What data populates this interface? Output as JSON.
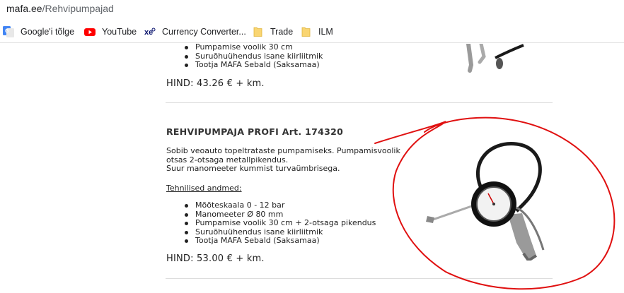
{
  "browser": {
    "url_host": "mafa.ee",
    "url_path": "/Rehvipumpajad",
    "bookmarks": [
      {
        "label": "Google'i tõlge",
        "icon": "google-translate-icon"
      },
      {
        "label": "YouTube",
        "icon": "youtube-icon"
      },
      {
        "label": "Currency Converter...",
        "icon": "xe-icon"
      },
      {
        "label": "Trade",
        "icon": "folder-icon"
      },
      {
        "label": "ILM",
        "icon": "folder-icon"
      }
    ]
  },
  "product1": {
    "specs": [
      "Pumpamise voolik 30 cm",
      "Suruõhuühendus isane kiirliitmik",
      "Tootja MAFA Sebald (Saksamaa)"
    ],
    "price": "HIND: 43.26 € + km."
  },
  "product2": {
    "title": "REHVIPUMPAJA PROFI  Art. 174320",
    "desc_lines": [
      "Sobib veoauto topeltrataste pumpamiseks. Pumpamisvoolik",
      "otsas 2-otsaga metallpikendus.",
      "Suur manomeeter kummist turvaümbrisega."
    ],
    "tech_label": "Tehnilised andmed:",
    "specs": [
      "Mõõteskaala 0 - 12 bar",
      "Manomeeter Ø 80 mm",
      "Pumpamise voolik 30 cm + 2-otsaga pikendus",
      "Suruõhuühendus isane kiirliitmik",
      "Tootja MAFA Sebald (Saksamaa)"
    ],
    "price": "HIND: 53.00 € + km."
  },
  "colors": {
    "annotation": "#e01010",
    "link_text": "#202124"
  }
}
